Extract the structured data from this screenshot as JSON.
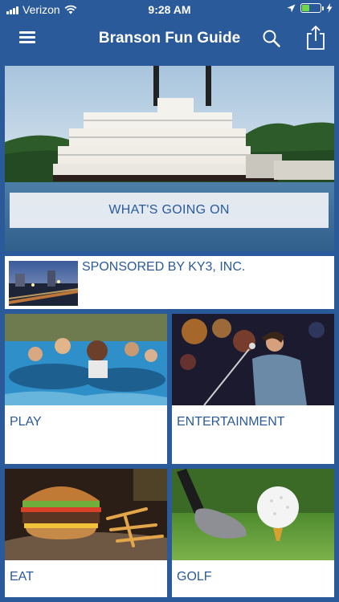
{
  "status": {
    "carrier": "Verizon",
    "time": "9:28 AM",
    "battery_color": "#6fd64a"
  },
  "nav": {
    "title": "Branson Fun Guide",
    "menu_icon": "hamburger-menu-icon",
    "search_icon": "search-icon",
    "share_icon": "share-icon"
  },
  "hero": {
    "banner_label": "WHAT'S GOING ON"
  },
  "sponsor": {
    "label": "SPONSORED BY KY3, INC."
  },
  "tiles": [
    {
      "label": "PLAY"
    },
    {
      "label": "ENTERTAINMENT"
    },
    {
      "label": "EAT"
    },
    {
      "label": "GOLF"
    }
  ],
  "colors": {
    "brand_blue": "#2b5a9a",
    "text_blue": "#2b5a9a"
  }
}
